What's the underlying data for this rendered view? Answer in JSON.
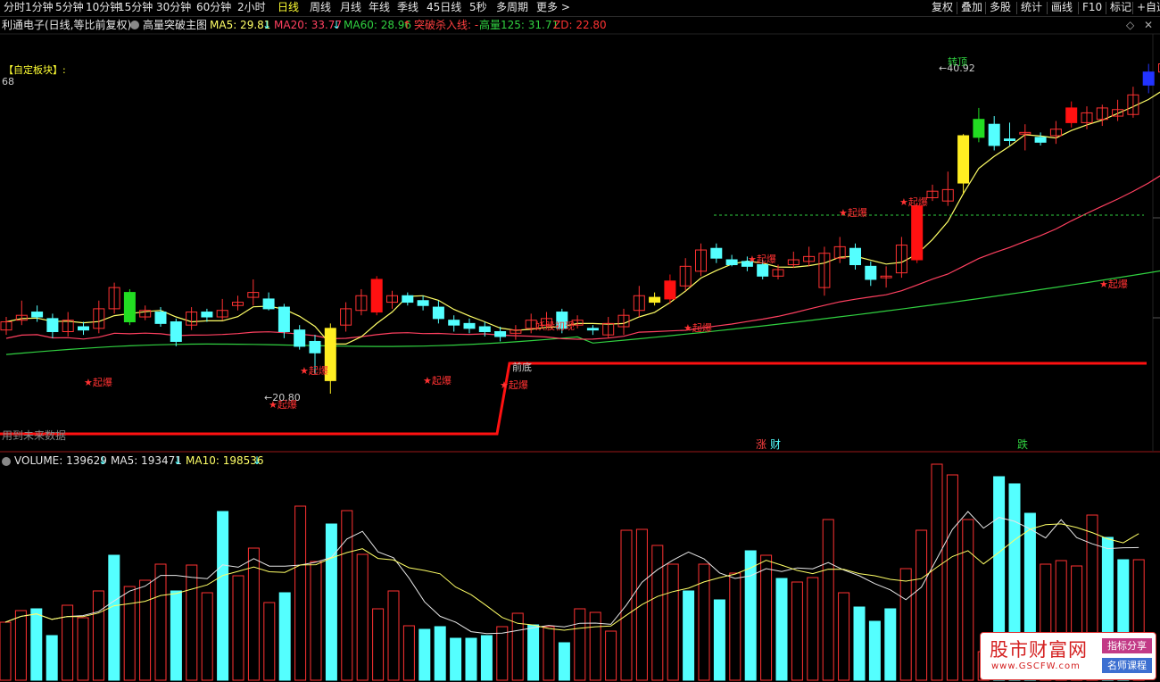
{
  "toolbar": {
    "periods": [
      "分时",
      "1分钟",
      "5分钟",
      "10分钟",
      "15分钟",
      "30分钟",
      "60分钟",
      "2小时",
      "日线",
      "周线",
      "月线",
      "年线",
      "季线",
      "45日线",
      "5秒",
      "多周期",
      "更多 >"
    ],
    "active_period": "日线",
    "right_items": [
      "复权",
      "叠加",
      "多股",
      "统计",
      "画线",
      "F10",
      "标记",
      "+自选"
    ]
  },
  "info": {
    "stock": "利通电子(日线,等比前复权)",
    "template": "高量突破主图",
    "ma5": "MA5: 29.81",
    "ma20": "MA20: 33.77",
    "ma60": "MA60: 28.96",
    "kill_line": "突破杀入线: -",
    "high_volume": "高量125: 31.71",
    "zd": "ZD: 22.80"
  },
  "main_chart": {
    "block_label": "【自定板块】:",
    "top_value": "68",
    "future_label": "用到未来数据",
    "max_price_label": "40.92",
    "min_price_label": "20.80",
    "top_label": "转顶",
    "prev_low_label": "前底",
    "demon_label": "妖股初现",
    "explode_label": "起爆",
    "rise_label": "涨",
    "wealth_label": "财",
    "fall_label": "跌"
  },
  "volume": {
    "volume": "VOLUME: 139629",
    "ma5": "MA5: 193471",
    "ma10": "MA10: 198536"
  },
  "watermark": {
    "logo": "股市财富网",
    "url": "www.GSCFW.com",
    "badge1": "指标分享",
    "badge2": "名师课程"
  },
  "colors": {
    "up": "#ff3232",
    "down": "#54ffff",
    "ma5": "#ffff66",
    "ma20": "#ff4060",
    "ma60": "#30d040",
    "signal_green": "#22dd22",
    "signal_yellow": "#ffee22",
    "signal_red": "#ff1111",
    "signal_blue": "#2233ff"
  }
}
